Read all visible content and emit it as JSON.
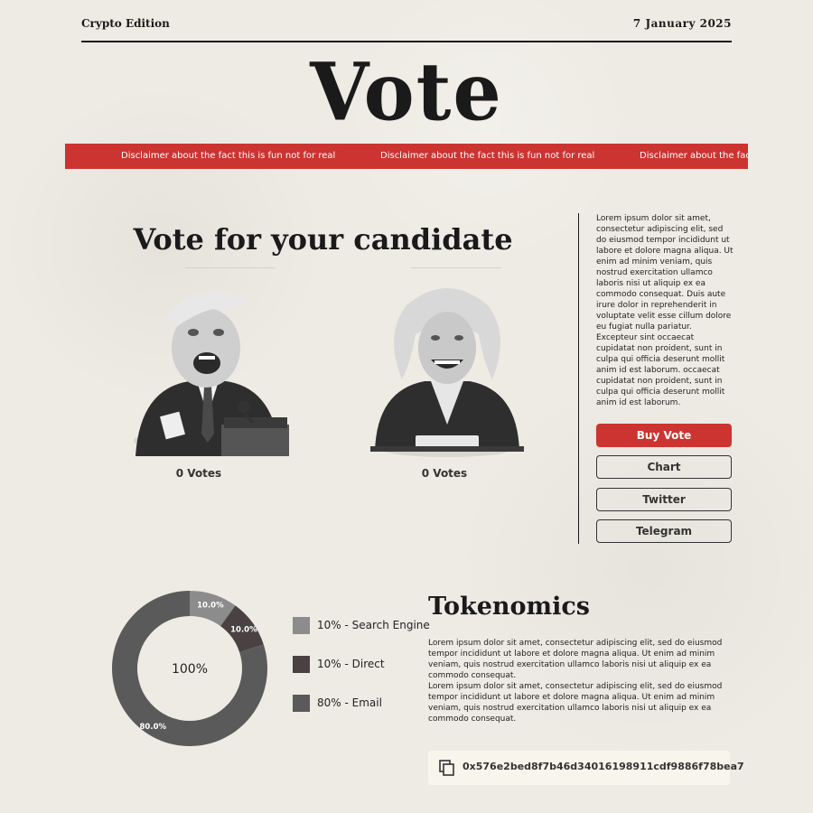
{
  "header": {
    "edition": "Crypto Edition",
    "date": "7 January 2025",
    "masthead": "Vote"
  },
  "banner": {
    "text": "Disclaimer about the fact this is fun not for real",
    "color": "#cb3431"
  },
  "vote": {
    "title": "Vote for your candidate",
    "candidates": [
      {
        "icon": "male-candidate-caricature",
        "votes": "0 Votes"
      },
      {
        "icon": "female-candidate-caricature",
        "votes": "0 Votes"
      }
    ]
  },
  "sidebar": {
    "text": "Lorem ipsum dolor sit amet, consectetur adipiscing elit, sed do eiusmod tempor incididunt ut labore et dolore magna aliqua. Ut enim ad minim veniam, quis nostrud exercitation ullamco laboris nisi ut aliquip ex ea commodo consequat. Duis aute irure dolor in reprehenderit in voluptate velit esse cillum dolore eu fugiat nulla pariatur. Excepteur sint occaecat cupidatat non proident, sunt in culpa qui officia deserunt mollit anim id est laborum. occaecat cupidatat non proident, sunt in culpa qui officia deserunt mollit anim id est laborum.",
    "buttons": {
      "buy": "Buy Vote",
      "chart": "Chart",
      "twitter": "Twitter",
      "telegram": "Telegram"
    },
    "accent": "#cb3431"
  },
  "chart_data": {
    "type": "pie",
    "donut": true,
    "center_label": "100%",
    "categories": [
      "Search Engine",
      "Direct",
      "Email"
    ],
    "values": [
      10,
      10,
      80
    ],
    "colors": [
      "#8c8c8c",
      "#4a4142",
      "#5a5a5a"
    ],
    "slice_labels": [
      "10.0%",
      "10.0%",
      "80.0%"
    ],
    "legend": [
      "10% - Search Engine",
      "10% - Direct",
      "80% - Email"
    ],
    "legend_position": "right"
  },
  "tokenomics": {
    "title": "Tokenomics",
    "paragraph1": "Lorem ipsum dolor sit amet, consectetur adipiscing elit, sed do eiusmod tempor incididunt ut labore et dolore magna aliqua. Ut enim ad minim veniam, quis nostrud exercitation ullamco laboris nisi ut aliquip ex ea commodo consequat.",
    "paragraph2": "Lorem ipsum dolor sit amet, consectetur adipiscing elit, sed do eiusmod tempor incididunt ut labore et dolore magna aliqua. Ut enim ad minim veniam, quis nostrud exercitation ullamco laboris nisi ut aliquip ex ea commodo consequat.",
    "address": "0x576e2bed8f7b46d34016198911cdf9886f78bea7",
    "copy_icon": "copy-icon"
  }
}
